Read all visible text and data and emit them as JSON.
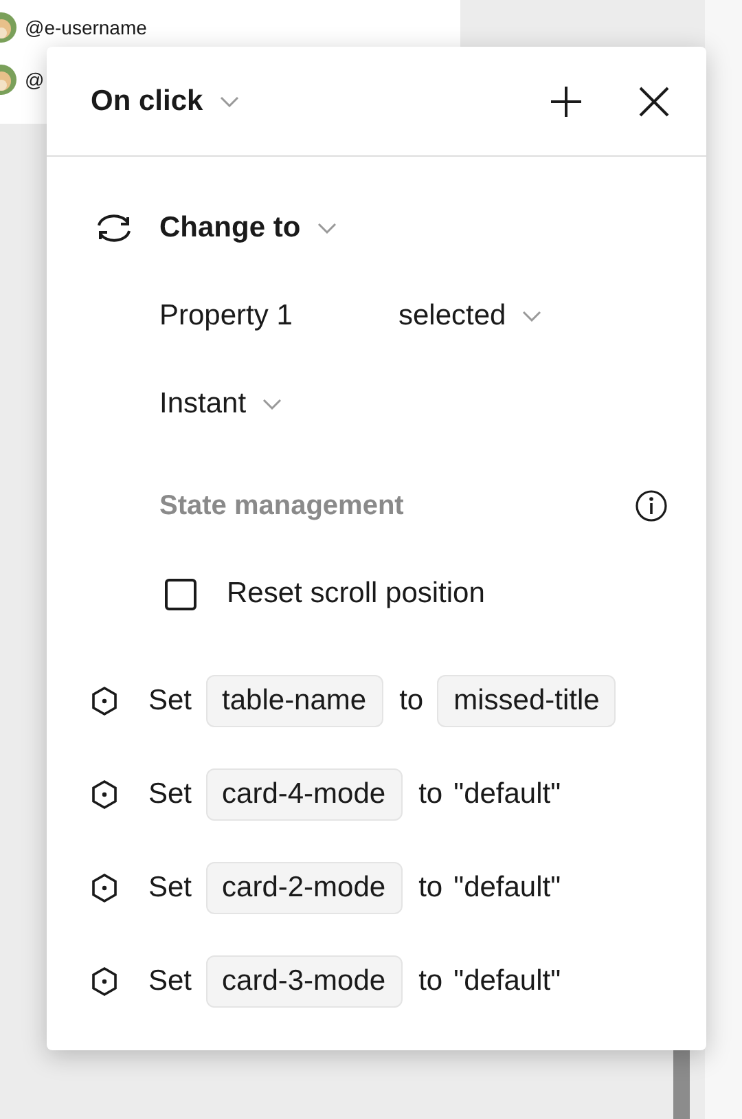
{
  "background_list": [
    {
      "handle": "@e-username"
    },
    {
      "handle": "@"
    }
  ],
  "popover": {
    "trigger": "On click",
    "action": "Change to",
    "property_label": "Property 1",
    "property_value": "selected",
    "transition": "Instant",
    "section_title": "State management",
    "reset_scroll": {
      "label": "Reset scroll position",
      "checked": false
    },
    "assignments": [
      {
        "verb": "Set",
        "target": "table-name",
        "connector": "to",
        "value": "missed-title",
        "kind": "variable"
      },
      {
        "verb": "Set",
        "target": "card-4-mode",
        "connector": "to",
        "value": "\"default\"",
        "kind": "literal"
      },
      {
        "verb": "Set",
        "target": "card-2-mode",
        "connector": "to",
        "value": "\"default\"",
        "kind": "literal"
      },
      {
        "verb": "Set",
        "target": "card-3-mode",
        "connector": "to",
        "value": "\"default\"",
        "kind": "literal"
      }
    ]
  }
}
